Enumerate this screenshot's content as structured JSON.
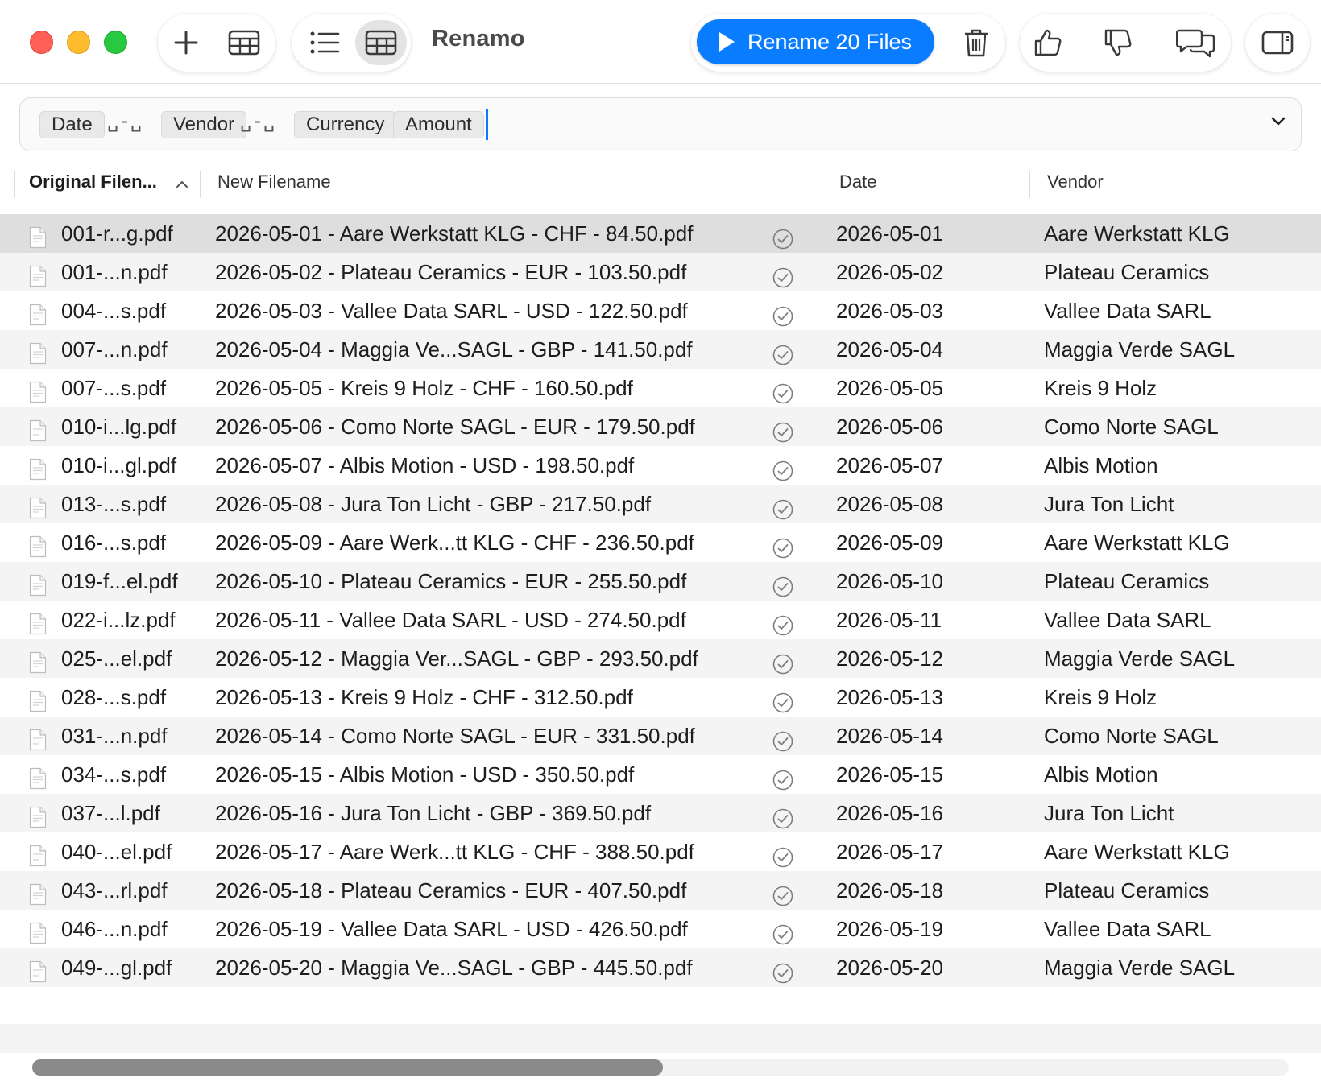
{
  "app": {
    "title": "Renamo"
  },
  "toolbar": {
    "rename_label": "Rename 20 Files",
    "icons": [
      "plus-icon",
      "table-icon",
      "list-icon",
      "grid-icon",
      "trash-icon",
      "thumbs-up-icon",
      "thumbs-down-icon",
      "chat-icon",
      "sidebar-icon"
    ],
    "accent": "#0a7cff"
  },
  "template": {
    "tokens": [
      "Date",
      "Vendor",
      "Currency",
      "Amount"
    ],
    "separators": [
      "␣-␣",
      "␣-␣"
    ]
  },
  "columns": {
    "original": "Original Filen...",
    "new": "New Filename",
    "status": "",
    "date": "Date",
    "vendor": "Vendor"
  },
  "rows": [
    {
      "original": "001-r...g.pdf",
      "new": "2026-05-01 - Aare Werkstatt KLG - CHF - 84.50.pdf",
      "date": "2026-05-01",
      "vendor": "Aare Werkstatt KLG"
    },
    {
      "original": "001-...n.pdf",
      "new": "2026-05-02 - Plateau Ceramics - EUR - 103.50.pdf",
      "date": "2026-05-02",
      "vendor": "Plateau Ceramics"
    },
    {
      "original": "004-...s.pdf",
      "new": "2026-05-03 - Vallee Data SARL - USD - 122.50.pdf",
      "date": "2026-05-03",
      "vendor": "Vallee Data SARL"
    },
    {
      "original": "007-...n.pdf",
      "new": "2026-05-04 - Maggia Ve...SAGL - GBP - 141.50.pdf",
      "date": "2026-05-04",
      "vendor": "Maggia Verde SAGL"
    },
    {
      "original": "007-...s.pdf",
      "new": "2026-05-05 - Kreis 9 Holz - CHF - 160.50.pdf",
      "date": "2026-05-05",
      "vendor": "Kreis 9 Holz"
    },
    {
      "original": "010-i...lg.pdf",
      "new": "2026-05-06 - Como Norte SAGL - EUR - 179.50.pdf",
      "date": "2026-05-06",
      "vendor": "Como Norte SAGL"
    },
    {
      "original": "010-i...gl.pdf",
      "new": "2026-05-07 - Albis Motion - USD - 198.50.pdf",
      "date": "2026-05-07",
      "vendor": "Albis Motion"
    },
    {
      "original": "013-...s.pdf",
      "new": "2026-05-08 - Jura Ton Licht - GBP - 217.50.pdf",
      "date": "2026-05-08",
      "vendor": "Jura Ton Licht"
    },
    {
      "original": "016-...s.pdf",
      "new": "2026-05-09 - Aare Werk...tt KLG - CHF - 236.50.pdf",
      "date": "2026-05-09",
      "vendor": "Aare Werkstatt KLG"
    },
    {
      "original": "019-f...el.pdf",
      "new": "2026-05-10 - Plateau Ceramics - EUR - 255.50.pdf",
      "date": "2026-05-10",
      "vendor": "Plateau Ceramics"
    },
    {
      "original": "022-i...lz.pdf",
      "new": "2026-05-11 - Vallee Data SARL - USD - 274.50.pdf",
      "date": "2026-05-11",
      "vendor": "Vallee Data SARL"
    },
    {
      "original": "025-...el.pdf",
      "new": "2026-05-12 - Maggia Ver...SAGL - GBP - 293.50.pdf",
      "date": "2026-05-12",
      "vendor": "Maggia Verde SAGL"
    },
    {
      "original": "028-...s.pdf",
      "new": "2026-05-13 - Kreis 9 Holz - CHF - 312.50.pdf",
      "date": "2026-05-13",
      "vendor": "Kreis 9 Holz"
    },
    {
      "original": "031-...n.pdf",
      "new": "2026-05-14 - Como Norte SAGL - EUR - 331.50.pdf",
      "date": "2026-05-14",
      "vendor": "Como Norte SAGL"
    },
    {
      "original": "034-...s.pdf",
      "new": "2026-05-15 - Albis Motion - USD - 350.50.pdf",
      "date": "2026-05-15",
      "vendor": "Albis Motion"
    },
    {
      "original": "037-...l.pdf",
      "new": "2026-05-16 - Jura Ton Licht - GBP - 369.50.pdf",
      "date": "2026-05-16",
      "vendor": "Jura Ton Licht"
    },
    {
      "original": "040-...el.pdf",
      "new": "2026-05-17 - Aare Werk...tt KLG - CHF - 388.50.pdf",
      "date": "2026-05-17",
      "vendor": "Aare Werkstatt KLG"
    },
    {
      "original": "043-...rl.pdf",
      "new": "2026-05-18 - Plateau Ceramics - EUR - 407.50.pdf",
      "date": "2026-05-18",
      "vendor": "Plateau Ceramics"
    },
    {
      "original": "046-...n.pdf",
      "new": "2026-05-19 - Vallee Data SARL - USD - 426.50.pdf",
      "date": "2026-05-19",
      "vendor": "Vallee Data SARL"
    },
    {
      "original": "049-...gl.pdf",
      "new": "2026-05-20 - Maggia Ve...SAGL - GBP - 445.50.pdf",
      "date": "2026-05-20",
      "vendor": "Maggia Verde SAGL"
    }
  ],
  "selected_row": 0,
  "scroll": {
    "horizontal_fraction_visible": 0.5
  }
}
